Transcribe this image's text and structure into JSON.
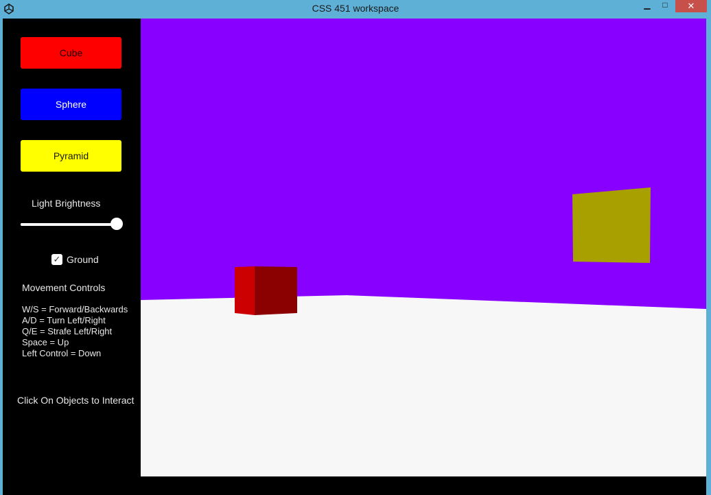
{
  "window": {
    "title": "CSS 451 workspace",
    "minimize_glyph": "▁",
    "maximize_glyph": "□",
    "close_glyph": "✕"
  },
  "panel": {
    "buttons": {
      "cube": "Cube",
      "sphere": "Sphere",
      "pyramid": "Pyramid"
    },
    "brightness": {
      "label": "Light Brightness",
      "value": 1.0
    },
    "ground": {
      "label": "Ground",
      "checked": true,
      "check_glyph": "✓"
    },
    "movement": {
      "title": "Movement Controls",
      "lines": [
        "W/S = Forward/Backwards",
        "A/D = Turn Left/Right",
        "Q/E = Strafe Left/Right",
        "Space = Up",
        "Left Control = Down"
      ]
    },
    "hint": "Click On Objects to Interact"
  },
  "scene": {
    "sky_color": "#8800ff",
    "ground_color": "#f7f7f7",
    "cube_front_color": "#cc0000",
    "cube_side_color": "#8b0000",
    "panel_object_color": "#a8a000"
  },
  "colors": {
    "titlebar": "#5fb0d6",
    "close_button": "#c7504a",
    "cube_button": "#ff0000",
    "sphere_button": "#0000ff",
    "pyramid_button": "#ffff00"
  }
}
